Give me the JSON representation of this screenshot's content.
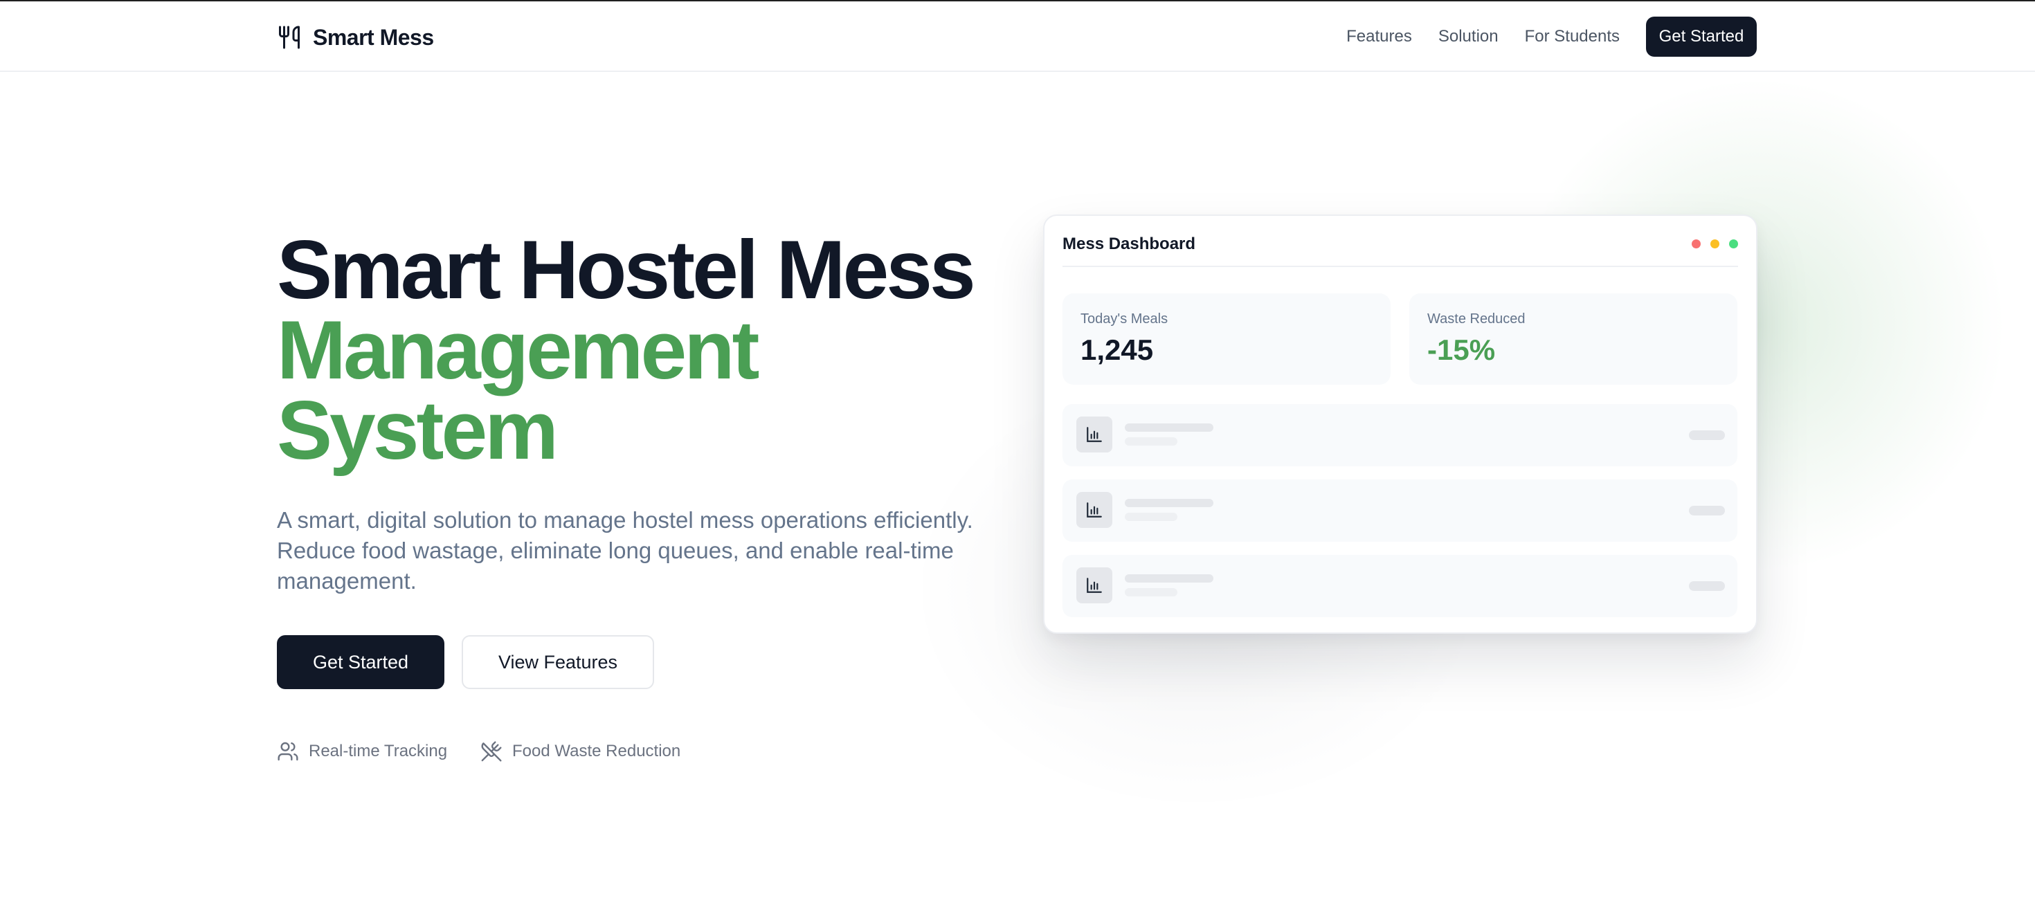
{
  "brand": {
    "name": "Smart Mess",
    "icon": "utensils-icon"
  },
  "nav": {
    "links": [
      "Features",
      "Solution",
      "For Students"
    ],
    "cta": "Get Started"
  },
  "hero": {
    "title_line1": "Smart Hostel Mess",
    "title_line2": "Management",
    "title_line3": "System",
    "subtitle": "A smart, digital solution to manage hostel mess operations efficiently. Reduce food wastage, eliminate long queues, and enable real-time management.",
    "primary_cta": "Get Started",
    "secondary_cta": "View Features",
    "features": [
      {
        "icon": "users-icon",
        "label": "Real-time Tracking"
      },
      {
        "icon": "utensils-crossed-icon",
        "label": "Food Waste Reduction"
      }
    ]
  },
  "dashboard": {
    "title": "Mess Dashboard",
    "window_dots": [
      "#f87171",
      "#fbbf24",
      "#4ade80"
    ],
    "stats": [
      {
        "label": "Today's Meals",
        "value": "1,245"
      },
      {
        "label": "Waste Reduced",
        "value": "-15%"
      }
    ],
    "rows": [
      {
        "icon": "bar-chart-icon"
      },
      {
        "icon": "bar-chart-icon"
      },
      {
        "icon": "bar-chart-icon"
      }
    ]
  },
  "colors": {
    "accent_green": "#4a9f54",
    "dark": "#111827",
    "muted_text": "#64748b"
  }
}
